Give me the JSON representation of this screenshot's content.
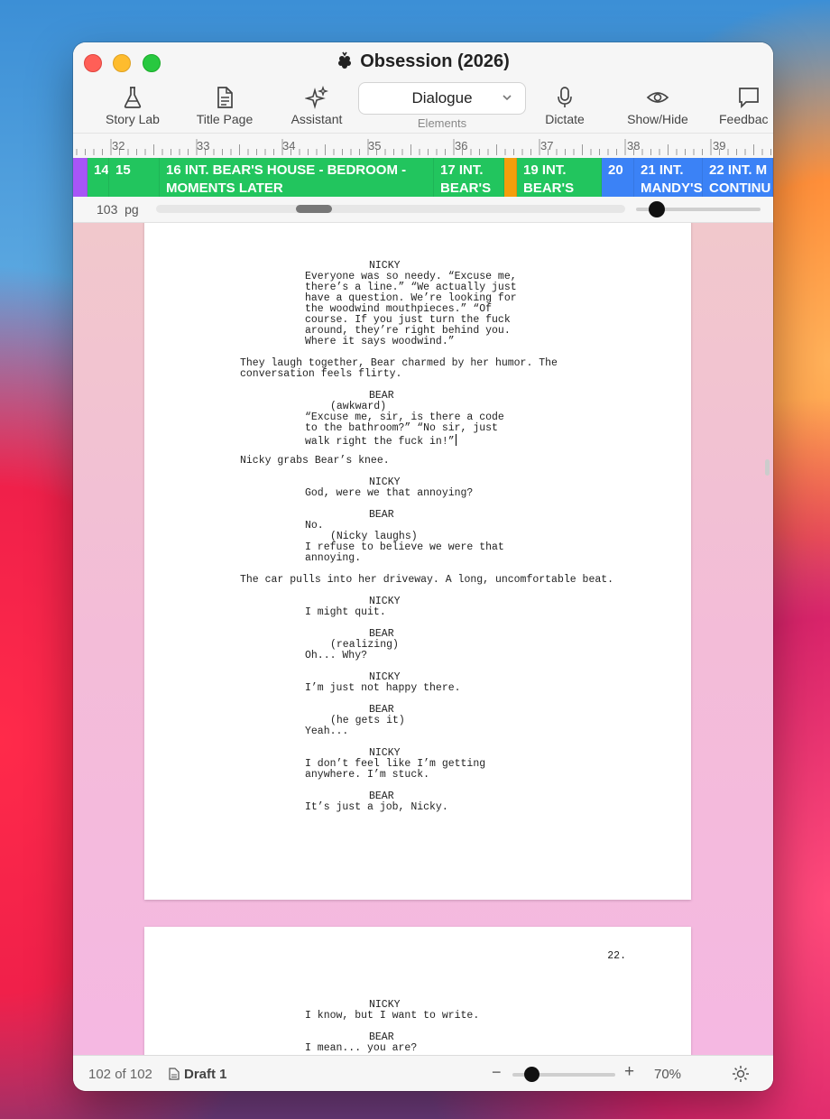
{
  "window": {
    "title": "Obsession (2026)"
  },
  "toolbar": {
    "story_lab": "Story Lab",
    "title_page": "Title Page",
    "assistant": "Assistant",
    "element_value": "Dialogue",
    "elements_label": "Elements",
    "dictate": "Dictate",
    "show_hide": "Show/Hide",
    "feedback": "Feedbac"
  },
  "ruler": {
    "ticks": [
      "32",
      "33",
      "34",
      "35",
      "36",
      "37",
      "38",
      "39"
    ]
  },
  "scenes": [
    {
      "label": "",
      "color": "#a855f7"
    },
    {
      "label": "14",
      "color": "#22c55e"
    },
    {
      "label": "15",
      "color": "#22c55e"
    },
    {
      "label": "16 INT. BEAR'S HOUSE - BEDROOM - MOMENTS LATER",
      "color": "#22c55e"
    },
    {
      "label": "17 INT. BEAR'S",
      "color": "#22c55e"
    },
    {
      "label": "",
      "color": "#f59e0b"
    },
    {
      "label": "19 INT. BEAR'S",
      "color": "#22c55e"
    },
    {
      "label": "20",
      "color": "#3b82f6"
    },
    {
      "label": "21 INT. MANDY'S",
      "color": "#3b82f6"
    },
    {
      "label": "22 INT. M CONTINU",
      "color": "#3b82f6"
    }
  ],
  "pagebar": {
    "page_count": "103",
    "unit": "pg"
  },
  "script_page1": [
    {
      "type": "char",
      "text": "NICKY"
    },
    {
      "type": "dial",
      "text": "Everyone was so needy. “Excuse me,"
    },
    {
      "type": "dial",
      "text": "there’s a line.” “We actually just"
    },
    {
      "type": "dial",
      "text": "have a question. We’re looking for"
    },
    {
      "type": "dial",
      "text": "the woodwind mouthpieces.” “Of"
    },
    {
      "type": "dial",
      "text": "course. If you just turn the fuck"
    },
    {
      "type": "dial",
      "text": "around, they’re right behind you."
    },
    {
      "type": "dial",
      "text": "Where it says woodwind.”"
    },
    {
      "type": "gap"
    },
    {
      "type": "act",
      "text": "They laugh together, Bear charmed by her humor. The"
    },
    {
      "type": "act",
      "text": "conversation feels flirty."
    },
    {
      "type": "gap"
    },
    {
      "type": "char",
      "text": "BEAR"
    },
    {
      "type": "paren",
      "text": "(awkward)"
    },
    {
      "type": "dial",
      "text": "“Excuse me, sir, is there a code"
    },
    {
      "type": "dial",
      "text": "to the bathroom?” “No sir, just"
    },
    {
      "type": "dial",
      "text": "walk right the fuck in!”",
      "caret": true
    },
    {
      "type": "gap"
    },
    {
      "type": "act",
      "text": "Nicky grabs Bear’s knee."
    },
    {
      "type": "gap"
    },
    {
      "type": "char",
      "text": "NICKY"
    },
    {
      "type": "dial",
      "text": "God, were we that annoying?"
    },
    {
      "type": "gap"
    },
    {
      "type": "char",
      "text": "BEAR"
    },
    {
      "type": "dial",
      "text": "No."
    },
    {
      "type": "paren",
      "text": "(Nicky laughs)"
    },
    {
      "type": "dial",
      "text": "I refuse to believe we were that"
    },
    {
      "type": "dial",
      "text": "annoying."
    },
    {
      "type": "gap"
    },
    {
      "type": "act",
      "text": "The car pulls into her driveway. A long, uncomfortable beat."
    },
    {
      "type": "gap"
    },
    {
      "type": "char",
      "text": "NICKY"
    },
    {
      "type": "dial",
      "text": "I might quit."
    },
    {
      "type": "gap"
    },
    {
      "type": "char",
      "text": "BEAR"
    },
    {
      "type": "paren",
      "text": "(realizing)"
    },
    {
      "type": "dial",
      "text": "Oh... Why?"
    },
    {
      "type": "gap"
    },
    {
      "type": "char",
      "text": "NICKY"
    },
    {
      "type": "dial",
      "text": "I’m just not happy there."
    },
    {
      "type": "gap"
    },
    {
      "type": "char",
      "text": "BEAR"
    },
    {
      "type": "paren",
      "text": "(he gets it)"
    },
    {
      "type": "dial",
      "text": "Yeah..."
    },
    {
      "type": "gap"
    },
    {
      "type": "char",
      "text": "NICKY"
    },
    {
      "type": "dial",
      "text": "I don’t feel like I’m getting"
    },
    {
      "type": "dial",
      "text": "anywhere. I’m stuck."
    },
    {
      "type": "gap"
    },
    {
      "type": "char",
      "text": "BEAR"
    },
    {
      "type": "dial",
      "text": "It’s just a job, Nicky."
    }
  ],
  "script_page2": {
    "page_number": "22.",
    "lines": [
      {
        "type": "char",
        "text": "NICKY"
      },
      {
        "type": "dial",
        "text": "I know, but I want to write."
      },
      {
        "type": "gap"
      },
      {
        "type": "char",
        "text": "BEAR"
      },
      {
        "type": "dial",
        "text": "I mean... you are?"
      }
    ]
  },
  "status": {
    "pages": "102 of 102",
    "draft": "Draft 1",
    "zoom": "70%"
  }
}
